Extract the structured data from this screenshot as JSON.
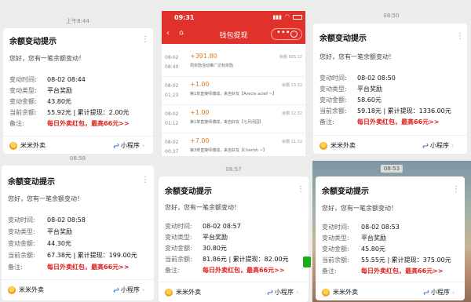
{
  "p1": {
    "time": "上午8:44",
    "title": "余额变动提示",
    "greeting": "您好，您有一笔余额变动！",
    "rows": [
      {
        "label": "变动时间:",
        "value": "08-02 08:44"
      },
      {
        "label": "变动类型:",
        "value": "平台奖励"
      },
      {
        "label": "变动金额:",
        "value": "43.80元"
      },
      {
        "label": "当前余额:",
        "value": "55.92元 | 累计提现：2.00元"
      },
      {
        "label": "备注:",
        "value": "每日外卖红包，最高66元>>"
      }
    ],
    "app_name": "米米外卖",
    "mini_label": "小程序"
  },
  "p2": {
    "time": "09:31",
    "nav_title": "钱包提现",
    "transactions": [
      {
        "date": "08-02",
        "time": "08:40",
        "amount": "+391.80",
        "desc": "周奖励活动推广达标奖励",
        "balance": "余额 605.12"
      },
      {
        "date": "08-02",
        "time": "01:23",
        "amount": "+1.00",
        "desc": "第1单直接师傅成，来自好友【Avecle aciell ~】",
        "balance": "余额 13.32"
      },
      {
        "date": "08-02",
        "time": "01:12",
        "amount": "+1.00",
        "desc": "第1单直接师傅成，来自好友【七月闲园】",
        "balance": "余额 12.32"
      },
      {
        "date": "08-02",
        "time": "00:37",
        "amount": "+7.00",
        "desc": "第3单直接师傅成，来自好友【Cherish ~】",
        "balance": "余额 11.32"
      }
    ]
  },
  "p3": {
    "time": "08:50",
    "title": "余额变动提示",
    "greeting": "您好，您有一笔余额变动！",
    "rows": [
      {
        "label": "变动时间:",
        "value": "08-02 08:50"
      },
      {
        "label": "变动类型:",
        "value": "平台奖励"
      },
      {
        "label": "变动金额:",
        "value": "58.60元"
      },
      {
        "label": "当前余额:",
        "value": "59.18元 | 累计提现：1336.00元"
      },
      {
        "label": "备注:",
        "value": "每日外卖红包，最高66元>>"
      }
    ],
    "app_name": "米米外卖",
    "mini_label": "小程序"
  },
  "p4": {
    "time": "08:58",
    "title": "余额变动提示",
    "greeting": "您好，您有一笔余额变动！",
    "rows": [
      {
        "label": "变动时间:",
        "value": "08-02 08:58"
      },
      {
        "label": "变动类型:",
        "value": "平台奖励"
      },
      {
        "label": "变动金额:",
        "value": "44.30元"
      },
      {
        "label": "当前余额:",
        "value": "67.38元 | 累计提现：199.00元"
      },
      {
        "label": "备注:",
        "value": "每日外卖红包，最高66元>>"
      }
    ],
    "app_name": "米米外卖",
    "mini_label": "小程序"
  },
  "p5": {
    "time": "08:57",
    "title": "余额变动提示",
    "greeting": "您好，您有一笔余额变动！",
    "rows": [
      {
        "label": "变动时间:",
        "value": "08-02 08:57"
      },
      {
        "label": "变动类型:",
        "value": "平台奖励"
      },
      {
        "label": "变动金额:",
        "value": "30.80元"
      },
      {
        "label": "当前余额:",
        "value": "81.86元 | 累计提现：82.00元"
      },
      {
        "label": "备注:",
        "value": "每日外卖红包，最高66元>>"
      }
    ],
    "app_name": "米米外卖",
    "mini_label": "小程序"
  },
  "p6": {
    "time": "08:53",
    "title": "余额变动提示",
    "greeting": "您好，您有一笔余额变动！",
    "rows": [
      {
        "label": "变动时间:",
        "value": "08-02 08:53"
      },
      {
        "label": "变动类型:",
        "value": "平台奖励"
      },
      {
        "label": "变动金额:",
        "value": "45.80元"
      },
      {
        "label": "当前余额:",
        "value": "55.55元 | 累计提现：375.00元"
      },
      {
        "label": "备注:",
        "value": "每日外卖红包，最高66元>>"
      }
    ],
    "app_name": "米米外卖",
    "mini_label": "小程序"
  },
  "colors": {
    "accent_red": "#e02020",
    "nav_red": "#e0322b",
    "amount_orange": "#e07a20"
  }
}
